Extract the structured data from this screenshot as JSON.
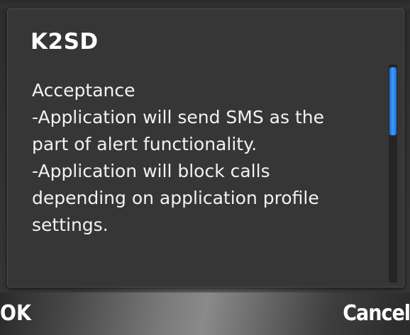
{
  "dialog": {
    "title": "K2SD",
    "body_lines": [
      "Acceptance",
      "-Application will send SMS as the",
      "part of alert functionality.",
      "-Application will block calls",
      "depending on application profile",
      "settings."
    ]
  },
  "softkeys": {
    "left_label": "OK",
    "right_label": "Cancel"
  },
  "colors": {
    "scroll_thumb": "#2e8cf0",
    "dialog_background": "#363636",
    "text": "#ffffff"
  }
}
